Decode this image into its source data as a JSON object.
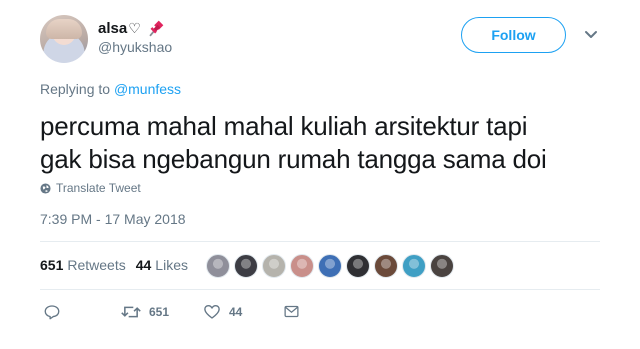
{
  "user": {
    "display_name": "alsa",
    "heart_glyph": "♡",
    "handle": "@hyukshao"
  },
  "header": {
    "follow_label": "Follow"
  },
  "reply": {
    "prefix": "Replying to ",
    "mention": "@munfess"
  },
  "tweet": {
    "lines": [
      "percuma mahal mahal kuliah arsitektur tapi",
      "gak bisa ngebangun rumah tangga sama doi"
    ],
    "translate_label": "Translate Tweet",
    "timestamp": "7:39 PM - 17 May 2018"
  },
  "stats": {
    "retweets_count": "651",
    "retweets_label": "Retweets",
    "likes_count": "44",
    "likes_label": "Likes"
  },
  "likers": [
    {
      "color": "#8f8f9a",
      "icon": "avatar"
    },
    {
      "color": "#3d3d44",
      "icon": "avatar"
    },
    {
      "color": "#b5b3ac",
      "icon": "avatar"
    },
    {
      "color": "#c98f8a",
      "icon": "avatar"
    },
    {
      "color": "#3e6fb5",
      "icon": "avatar"
    },
    {
      "color": "#2f2f33",
      "icon": "avatar"
    },
    {
      "color": "#6b4a3a",
      "icon": "avatar"
    },
    {
      "color": "#3f9fc4",
      "icon": "avatar"
    },
    {
      "color": "#4a4340",
      "icon": "avatar"
    }
  ],
  "actions": {
    "reply_icon": "reply-icon",
    "retweet_icon": "retweet-icon",
    "retweet_count": "651",
    "like_icon": "heart-icon",
    "like_count": "44",
    "dm_icon": "envelope-icon"
  },
  "colors": {
    "accent": "#1da1f2",
    "muted": "#657786",
    "text": "#14171a"
  }
}
